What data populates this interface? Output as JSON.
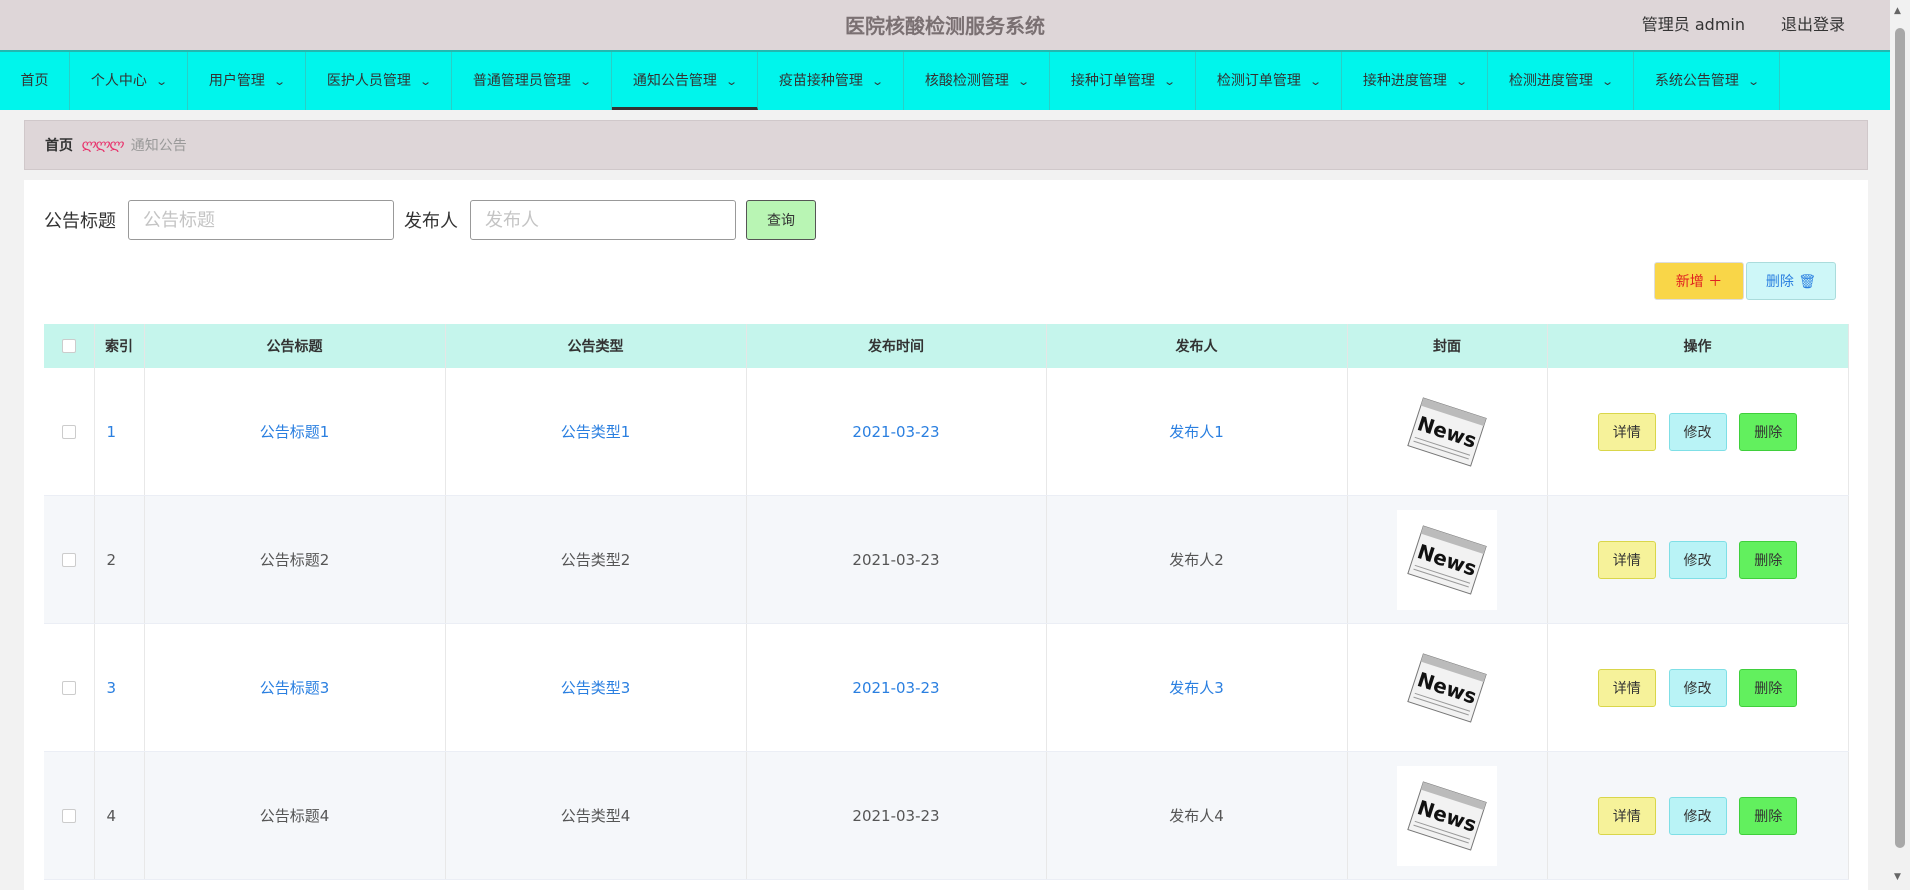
{
  "header": {
    "title": "医院核酸检测服务系统",
    "user": "管理员 admin",
    "logout": "退出登录"
  },
  "nav": [
    {
      "label": "首页",
      "has_menu": false,
      "active": false,
      "width": 70
    },
    {
      "label": "个人中心",
      "has_menu": true,
      "active": false,
      "width": 118
    },
    {
      "label": "用户管理",
      "has_menu": true,
      "active": false,
      "width": 118
    },
    {
      "label": "医护人员管理",
      "has_menu": true,
      "active": false,
      "width": 146
    },
    {
      "label": "普通管理员管理",
      "has_menu": true,
      "active": false,
      "width": 160
    },
    {
      "label": "通知公告管理",
      "has_menu": true,
      "active": true,
      "width": 146
    },
    {
      "label": "疫苗接种管理",
      "has_menu": true,
      "active": false,
      "width": 146
    },
    {
      "label": "核酸检测管理",
      "has_menu": true,
      "active": false,
      "width": 146
    },
    {
      "label": "接种订单管理",
      "has_menu": true,
      "active": false,
      "width": 146
    },
    {
      "label": "检测订单管理",
      "has_menu": true,
      "active": false,
      "width": 146
    },
    {
      "label": "接种进度管理",
      "has_menu": true,
      "active": false,
      "width": 146
    },
    {
      "label": "检测进度管理",
      "has_menu": true,
      "active": false,
      "width": 146
    },
    {
      "label": "系统公告管理",
      "has_menu": true,
      "active": false,
      "width": 146
    }
  ],
  "breadcrumb": {
    "home": "首页",
    "separator": "ლლლ",
    "current": "通知公告"
  },
  "search": {
    "title_label": "公告标题",
    "title_placeholder": "公告标题",
    "publisher_label": "发布人",
    "publisher_placeholder": "发布人",
    "query_button": "查询"
  },
  "actions": {
    "add_label": "新增 ＋",
    "delete_label": "删除 🗑"
  },
  "table": {
    "columns": [
      "索引",
      "公告标题",
      "公告类型",
      "发布时间",
      "发布人",
      "封面",
      "操作"
    ],
    "rows": [
      {
        "index": "1",
        "title": "公告标题1",
        "type": "公告类型1",
        "time": "2021-03-23",
        "publisher": "发布人1"
      },
      {
        "index": "2",
        "title": "公告标题2",
        "type": "公告类型2",
        "time": "2021-03-23",
        "publisher": "发布人2"
      },
      {
        "index": "3",
        "title": "公告标题3",
        "type": "公告类型3",
        "time": "2021-03-23",
        "publisher": "发布人3"
      },
      {
        "index": "4",
        "title": "公告标题4",
        "type": "公告类型4",
        "time": "2021-03-23",
        "publisher": "发布人4"
      }
    ],
    "row_actions": {
      "detail": "详情",
      "edit": "修改",
      "delete": "删除"
    },
    "cover_text": "News"
  },
  "colors": {
    "nav_bg": "#00f5ec",
    "header_bg": "#ded6d8",
    "table_head_bg": "#c5f5ec",
    "link_blue": "#2a7fe0"
  }
}
